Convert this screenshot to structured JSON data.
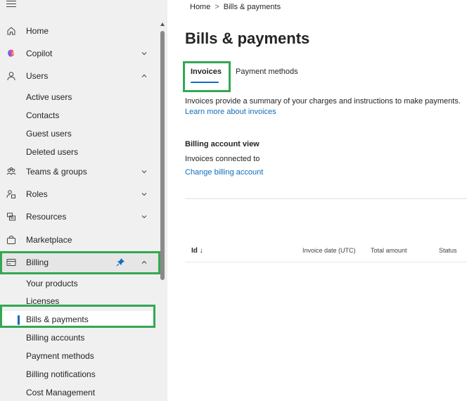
{
  "sidebar": {
    "items": [
      {
        "label": "Home",
        "icon": "home-icon"
      },
      {
        "label": "Copilot",
        "icon": "copilot-icon"
      },
      {
        "label": "Users",
        "icon": "person-icon"
      },
      {
        "label": "Teams & groups",
        "icon": "people-team-icon"
      },
      {
        "label": "Roles",
        "icon": "person-key-icon"
      },
      {
        "label": "Resources",
        "icon": "resources-icon"
      },
      {
        "label": "Marketplace",
        "icon": "shopping-bag-icon"
      },
      {
        "label": "Billing",
        "icon": "billing-card-icon"
      }
    ],
    "users_sub": [
      "Active users",
      "Contacts",
      "Guest users",
      "Deleted users"
    ],
    "billing_sub": [
      "Your products",
      "Licenses",
      "Bills & payments",
      "Billing accounts",
      "Payment methods",
      "Billing notifications",
      "Cost Management"
    ]
  },
  "breadcrumb": {
    "home": "Home",
    "sep": ">",
    "current": "Bills & payments"
  },
  "page": {
    "title": "Bills & payments"
  },
  "tabs": [
    {
      "label": "Invoices",
      "active": true
    },
    {
      "label": "Payment methods",
      "active": false
    }
  ],
  "invoices": {
    "description": "Invoices provide a summary of your charges and instructions to make payments.",
    "learn_more": "Learn more about invoices",
    "billing_account_title": "Billing account view",
    "connected_text": "Invoices connected to",
    "change_link": "Change billing account"
  },
  "table": {
    "headers": {
      "id": "Id ↓",
      "invoice_date": "Invoice date (UTC)",
      "total_amount": "Total amount",
      "status": "Status"
    }
  },
  "colors": {
    "accent": "#0f6cbd",
    "highlight": "#33a852",
    "sidebar_bg": "#f0f0f0"
  }
}
